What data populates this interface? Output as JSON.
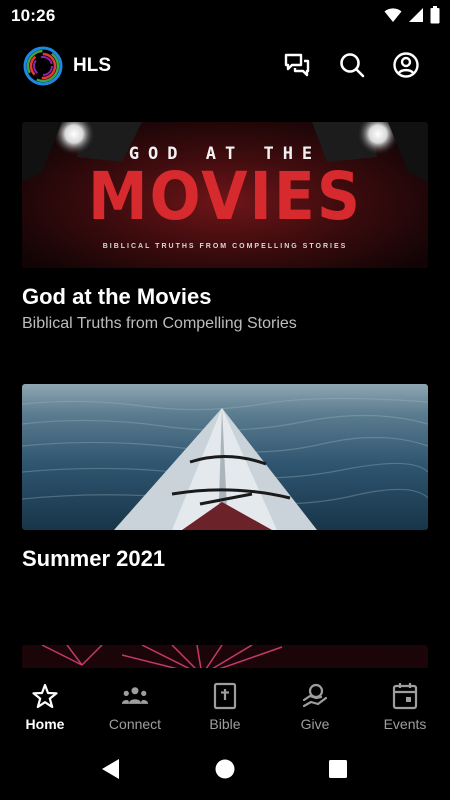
{
  "status_bar": {
    "time": "10:26"
  },
  "app_bar": {
    "title": "HLS"
  },
  "feed": {
    "cards": [
      {
        "title": "God at the Movies",
        "subtitle": "Biblical Truths from Compelling Stories",
        "banner": {
          "top": "GOD AT THE",
          "main": "MOVIES",
          "tagline": "BIBLICAL TRUTHS FROM COMPELLING STORIES"
        }
      },
      {
        "title": "Summer 2021"
      }
    ]
  },
  "bottom_nav": {
    "items": [
      {
        "label": "Home",
        "icon": "star-icon",
        "active": true
      },
      {
        "label": "Connect",
        "icon": "people-icon"
      },
      {
        "label": "Bible",
        "icon": "bible-icon"
      },
      {
        "label": "Give",
        "icon": "give-icon"
      },
      {
        "label": "Events",
        "icon": "calendar-icon"
      }
    ]
  },
  "colors": {
    "background": "#000000",
    "subtitle": "#bdbdbd",
    "inactive_nav": "#9e9e9e",
    "movies_red": "#d62a2e"
  }
}
